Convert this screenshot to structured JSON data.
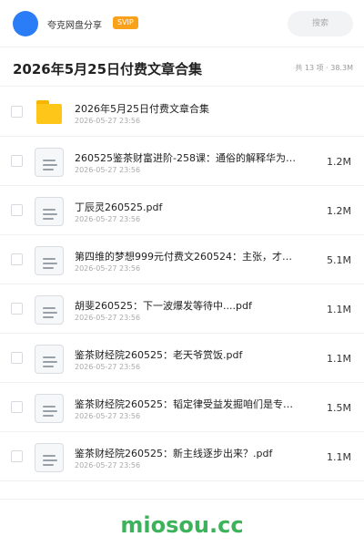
{
  "user": {
    "name": "夸克网盘分享",
    "badge": "SVIP"
  },
  "search": {
    "label": "搜索"
  },
  "page": {
    "title": "2026年5月25日付费文章合集",
    "summary": "共 13 项 · 38.3M"
  },
  "files": [
    {
      "type": "folder",
      "name": "2026年5月25日付费文章合集",
      "date": "2026-05-27 23:56",
      "size": ""
    },
    {
      "type": "doc",
      "name": "260525鉴茶财富进阶-258课：通俗的解释华为…",
      "date": "2026-05-27 23:56",
      "size": "1.2M"
    },
    {
      "type": "doc",
      "name": "丁辰灵260525.pdf",
      "date": "2026-05-27 23:56",
      "size": "1.2M"
    },
    {
      "type": "doc",
      "name": "第四维的梦想999元付费文260524：主张，才是…",
      "date": "2026-05-27 23:56",
      "size": "5.1M"
    },
    {
      "type": "doc",
      "name": "胡斐260525：下一波爆发等待中....pdf",
      "date": "2026-05-27 23:56",
      "size": "1.1M"
    },
    {
      "type": "doc",
      "name": "鉴茶财经院260525：老天爷赏饭.pdf",
      "date": "2026-05-27 23:56",
      "size": "1.1M"
    },
    {
      "type": "doc",
      "name": "鉴茶财经院260525：韬定律受益发掘咱们是专业的…",
      "date": "2026-05-27 23:56",
      "size": "1.5M"
    },
    {
      "type": "doc",
      "name": "鉴茶财经院260525：新主线逐步出来？.pdf",
      "date": "2026-05-27 23:56",
      "size": "1.1M"
    }
  ],
  "watermark": "miosou.cc",
  "colors": {
    "accent": "#2b7cf7",
    "svip": "#f9a11b",
    "folder": "#ffc61a",
    "watermark": "#3cb35a"
  }
}
